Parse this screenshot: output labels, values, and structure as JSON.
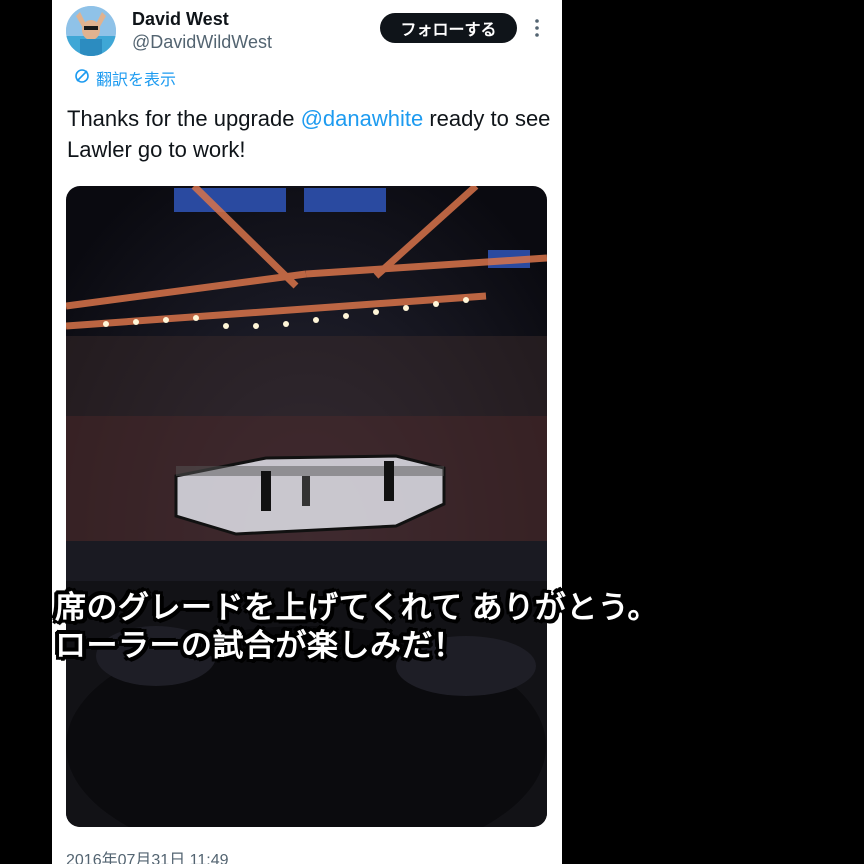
{
  "tweet": {
    "display_name": "David West",
    "handle": "@DavidWildWest",
    "follow_label": "フォローする",
    "translate_label": "翻訳を表示",
    "text_before": "Thanks for the upgrade ",
    "mention": "@danawhite",
    "text_after": " ready to see Lawler go to work!",
    "timestamp": "2016年07月31日 11:49"
  },
  "caption": {
    "line1": "席のグレードを上げてくれて ありがとう。",
    "line2": "ローラーの試合が楽しみだ！"
  },
  "icons": {
    "more": "more-vertical-icon",
    "translate": "translate-icon"
  },
  "colors": {
    "accent": "#1d9bf0",
    "text": "#0f1419",
    "muted": "#536471",
    "button_bg": "#0f1419"
  }
}
